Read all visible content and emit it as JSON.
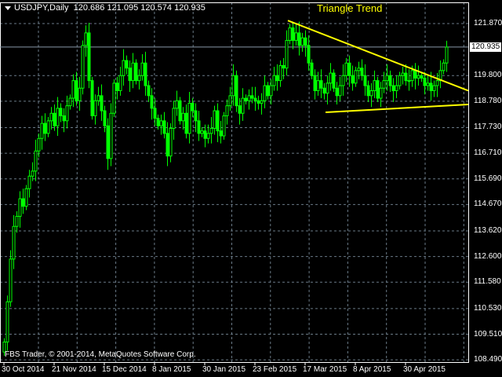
{
  "header": {
    "symbol": "USDJPY,Daily",
    "ohlc": "120.686 121.095 120.574 120.935"
  },
  "copyright": "FBS Trader, © 2001-2014, MetaQuotes Software Corp.",
  "colors": {
    "background": "#000000",
    "candle": "#00ff00",
    "trendline": "#ffff00",
    "grid": "#6a7a87",
    "axis": "#ffffff"
  },
  "chart_data": {
    "type": "candlestick",
    "title": "Triangle Trend",
    "symbol": "USDJPY",
    "timeframe": "Daily",
    "current_price": "120.935",
    "ylim": [
      108.49,
      121.87
    ],
    "y_ticks": [
      "121.870",
      "120.935",
      "119.800",
      "118.780",
      "117.730",
      "116.710",
      "115.690",
      "114.670",
      "113.620",
      "112.600",
      "111.580",
      "110.530",
      "109.510",
      "108.490"
    ],
    "y_tick_values": [
      121.87,
      119.8,
      118.78,
      117.73,
      116.71,
      115.69,
      114.67,
      113.62,
      112.6,
      111.58,
      110.53,
      109.51,
      108.49
    ],
    "x_ticks": [
      {
        "label": "30 Oct 2014",
        "bar": 0
      },
      {
        "label": "21 Nov 2014",
        "bar": 16
      },
      {
        "label": "15 Dec 2014",
        "bar": 32
      },
      {
        "label": "8 Jan 2015",
        "bar": 48
      },
      {
        "label": "30 Jan 2015",
        "bar": 64
      },
      {
        "label": "23 Feb 2015",
        "bar": 80
      },
      {
        "label": "17 Mar 2015",
        "bar": 96
      },
      {
        "label": "8 Apr 2015",
        "bar": 112
      },
      {
        "label": "30 Apr 2015",
        "bar": 128
      }
    ],
    "first_open": 108.8,
    "closes": [
      109.2,
      110.8,
      112.5,
      113.8,
      114.2,
      114.9,
      114.6,
      115.3,
      115.8,
      116.0,
      116.8,
      117.3,
      117.9,
      117.5,
      118.0,
      118.3,
      117.8,
      118.5,
      118.2,
      118.0,
      118.6,
      118.9,
      119.6,
      118.8,
      119.3,
      121.0,
      121.5,
      119.6,
      118.2,
      118.8,
      119.0,
      118.4,
      117.8,
      116.5,
      118.3,
      119.5,
      119.2,
      119.8,
      120.4,
      120.1,
      119.6,
      120.3,
      119.6,
      119.8,
      120.3,
      119.4,
      119.0,
      118.5,
      118.1,
      117.8,
      118.0,
      117.5,
      116.6,
      117.7,
      118.5,
      118.8,
      118.0,
      118.3,
      117.5,
      118.7,
      118.4,
      118.0,
      117.5,
      117.6,
      117.3,
      117.5,
      117.7,
      118.4,
      117.6,
      117.4,
      118.2,
      118.6,
      119.0,
      119.8,
      118.6,
      118.3,
      118.9,
      118.8,
      119.0,
      118.9,
      118.8,
      118.7,
      118.8,
      119.4,
      119.0,
      119.4,
      119.8,
      119.6,
      120.2,
      120.1,
      121.2,
      121.7,
      121.2,
      121.5,
      121.0,
      121.3,
      121.0,
      120.3,
      119.8,
      119.2,
      119.6,
      119.3,
      119.1,
      119.5,
      119.9,
      119.3,
      119.0,
      119.4,
      119.8,
      120.3,
      119.8,
      119.5,
      120.0,
      120.1,
      119.8,
      119.4,
      119.0,
      119.2,
      119.6,
      118.9,
      119.3,
      119.6,
      119.8,
      119.4,
      119.2,
      119.4,
      119.8,
      119.9,
      119.6,
      119.6,
      120.0,
      119.7,
      119.8,
      119.7,
      119.4,
      119.5,
      119.2,
      119.4,
      119.6,
      120.0,
      120.3,
      120.935
    ],
    "trendlines": [
      {
        "name": "upper",
        "from": {
          "bar": 90.5,
          "price": 121.99
        },
        "to": {
          "bar": 148,
          "price": 119.2
        }
      },
      {
        "name": "lower",
        "from": {
          "bar": 102.5,
          "price": 118.34
        },
        "to": {
          "bar": 148,
          "price": 118.65
        }
      }
    ]
  }
}
